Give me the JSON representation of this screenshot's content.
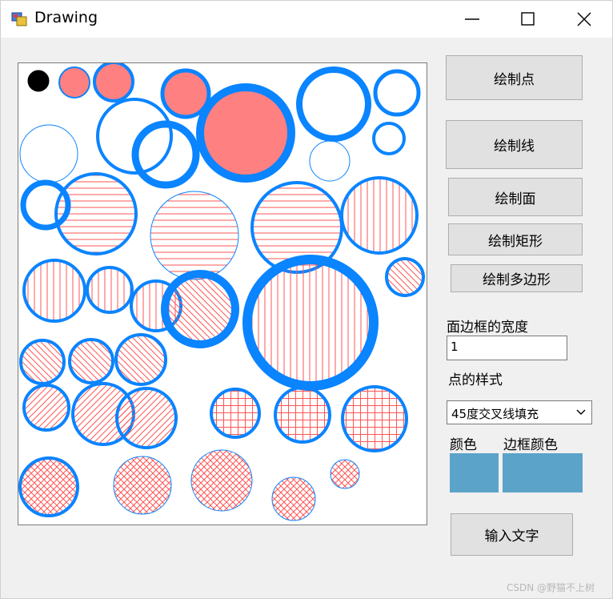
{
  "window": {
    "title": "Drawing",
    "icon": "app-icon"
  },
  "buttons": {
    "draw_point": "绘制点",
    "draw_line": "绘制线",
    "draw_area": "绘制面",
    "draw_rect": "绘制矩形",
    "draw_polygon": "绘制多边形",
    "input_text": "输入文字"
  },
  "border_width": {
    "label": "面边框的宽度",
    "value": "1"
  },
  "point_style": {
    "label": "点的样式",
    "selected": "45度交叉线填充"
  },
  "colors": {
    "fill_label": "颜色",
    "border_label": "边框颜色",
    "fill_color": "#5ba3c9",
    "border_color": "#5ba3c9",
    "circle_stroke": "#0a84ff",
    "circle_fill": "#ff8080",
    "hatch_color": "#ff5555",
    "point_color": "#000000"
  },
  "watermark": "CSDN @野猫不上树"
}
